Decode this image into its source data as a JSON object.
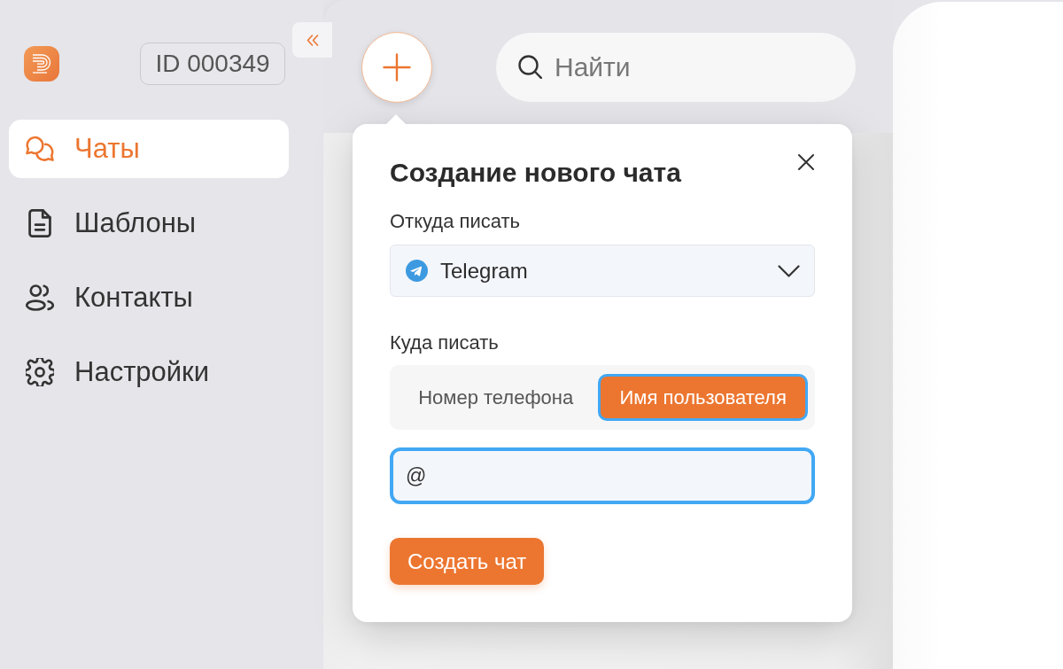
{
  "sidebar": {
    "account_id": "ID 000349",
    "items": [
      {
        "label": "Чаты",
        "selected": true
      },
      {
        "label": "Шаблоны",
        "selected": false
      },
      {
        "label": "Контакты",
        "selected": false
      },
      {
        "label": "Настройки",
        "selected": false
      }
    ]
  },
  "toolbar": {
    "search": {
      "placeholder": "Найти"
    }
  },
  "new_chat_popover": {
    "title": "Создание нового чата",
    "source_label": "Откуда писать",
    "source_select": {
      "value": "Telegram"
    },
    "target_label": "Куда писать",
    "target_options": [
      {
        "label": "Номер телефона",
        "selected": false
      },
      {
        "label": "Имя пользователя",
        "selected": true
      }
    ],
    "recipient_field": {
      "value": "@",
      "focused": true
    },
    "submit_button": "Создать чат"
  }
}
